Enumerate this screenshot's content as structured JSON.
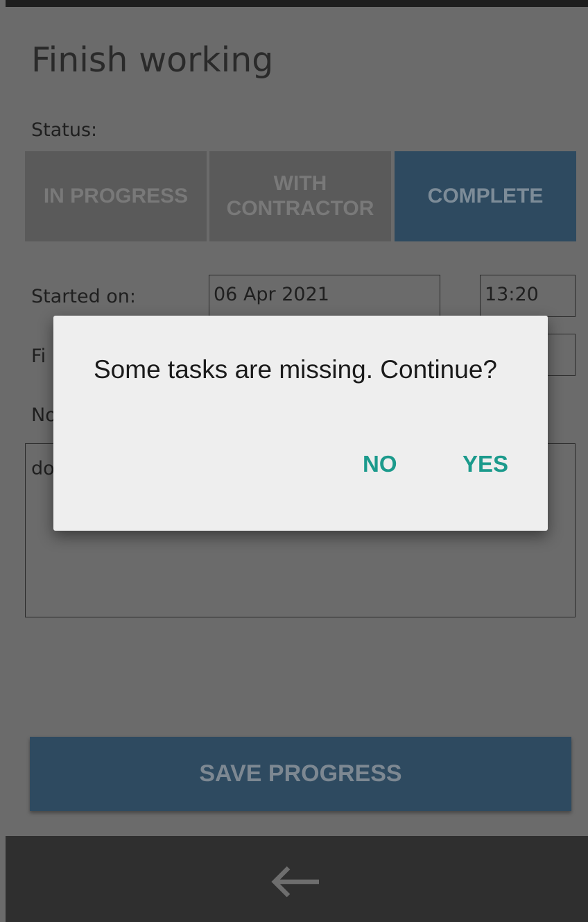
{
  "page": {
    "title": "Finish working"
  },
  "status": {
    "label": "Status:",
    "options": [
      {
        "label": "IN PROGRESS",
        "selected": false
      },
      {
        "label": "WITH CONTRACTOR",
        "selected": false
      },
      {
        "label": "COMPLETE",
        "selected": true
      }
    ]
  },
  "started": {
    "label": "Started on:",
    "date": "06 Apr 2021",
    "time": "13:20"
  },
  "finished": {
    "label": "Fi"
  },
  "notes": {
    "label": "No",
    "value": "do"
  },
  "save": {
    "label": "SAVE PROGRESS"
  },
  "dialog": {
    "message": "Some tasks are missing. Continue?",
    "no_label": "NO",
    "yes_label": "YES"
  },
  "nav": {
    "back_icon": "arrow-left-icon"
  },
  "colors": {
    "accent": "#2e4a60",
    "dialog_button": "#1b9a8c",
    "scrim": "#6b6b6b"
  }
}
